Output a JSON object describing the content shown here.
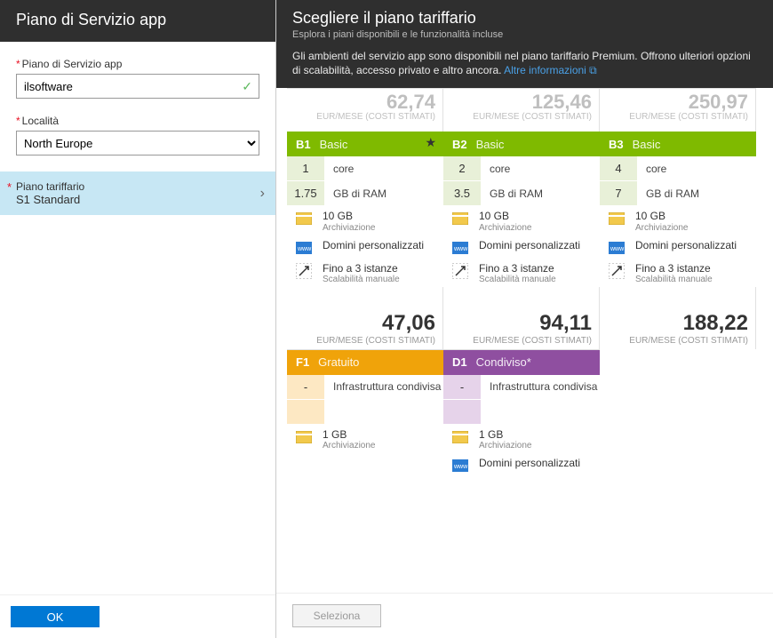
{
  "left": {
    "title": "Piano di Servizio app",
    "name_label": "Piano di Servizio app",
    "name_value": "ilsoftware",
    "location_label": "Località",
    "location_value": "North Europe",
    "tariff_label": "Piano tariffario",
    "tariff_value": "S1 Standard",
    "ok": "OK"
  },
  "right": {
    "title": "Scegliere il piano tariffario",
    "subtitle": "Esplora i piani disponibili e le funzionalità incluse",
    "desc": "Gli ambienti del servizio app sono disponibili nel piano tariffario Premium. Offrono ulteriori opzioni di scalabilità, accesso privato e altro ancora.",
    "link": "Altre informazioni",
    "select": "Seleziona",
    "price_sub": "EUR/MESE (COSTI STIMATI)",
    "top_prices": [
      "62,74",
      "125,46",
      "250,97"
    ],
    "basic": [
      {
        "code": "B1",
        "name": "Basic",
        "cores": "1",
        "ram": "1.75",
        "price": "47,06",
        "star": true
      },
      {
        "code": "B2",
        "name": "Basic",
        "cores": "2",
        "ram": "3.5",
        "price": "94,11",
        "star": false
      },
      {
        "code": "B3",
        "name": "Basic",
        "cores": "4",
        "ram": "7",
        "price": "188,22",
        "star": false
      }
    ],
    "labels": {
      "core": "core",
      "ram": "GB di RAM",
      "storage_val": "10 GB",
      "storage_txt": "Archiviazione",
      "domains": "Domini personalizzati",
      "instances_val": "Fino a 3 istanze",
      "instances_txt": "Scalabilità manuale",
      "infra": "Infrastruttura condivisa",
      "storage1g": "1 GB"
    },
    "bottom": [
      {
        "code": "F1",
        "name": "Gratuito"
      },
      {
        "code": "D1",
        "name": "Condiviso*"
      }
    ]
  }
}
